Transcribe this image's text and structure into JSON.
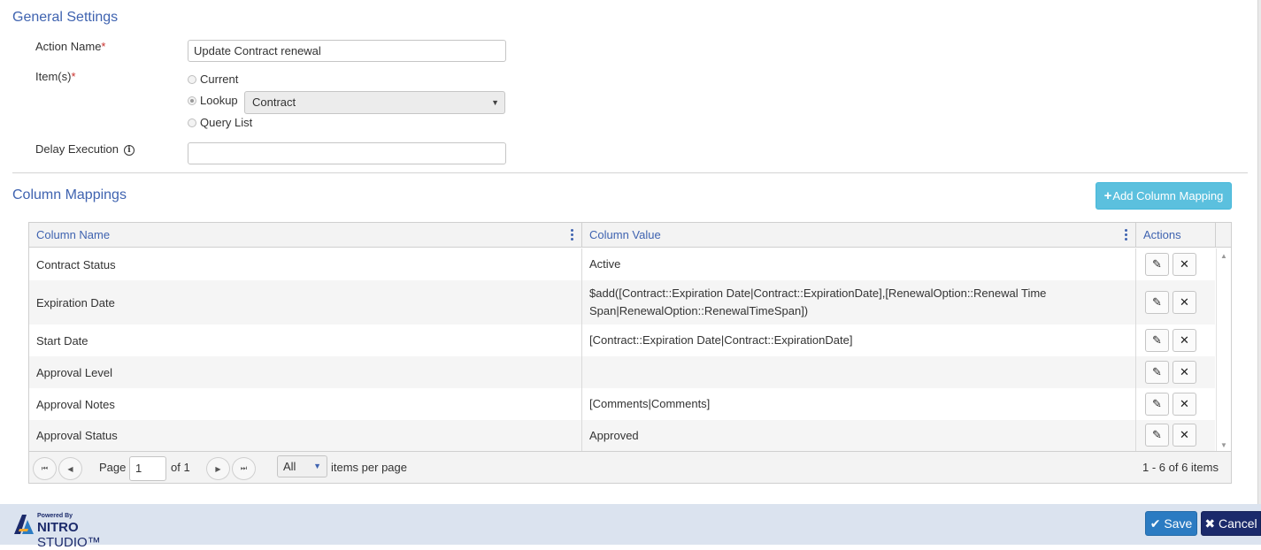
{
  "general": {
    "title": "General Settings",
    "action_name_label": "Action Name",
    "required_mark": "*",
    "action_name_value": "Update Contract renewal",
    "items_label": "Item(s)",
    "radio_options": [
      "Current",
      "Lookup",
      "Query List"
    ],
    "selected_radio": "Lookup",
    "lookup_select_value": "Contract",
    "delay_label": "Delay Execution",
    "info_icon": "i",
    "delay_value": ""
  },
  "mappings": {
    "title": "Column Mappings",
    "add_button_label": "Add Column Mapping",
    "add_button_icon": "+",
    "columns": [
      "Column Name",
      "Column Value",
      "Actions"
    ],
    "rows": [
      {
        "name": "Contract Status",
        "value": "Active"
      },
      {
        "name": "Expiration Date",
        "value": "$add([Contract::Expiration Date|Contract::ExpirationDate],[RenewalOption::Renewal Time Span|RenewalOption::RenewalTimeSpan])"
      },
      {
        "name": "Start Date",
        "value": "[Contract::Expiration Date|Contract::ExpirationDate]"
      },
      {
        "name": "Approval Level",
        "value": ""
      },
      {
        "name": "Approval Notes",
        "value": "[Comments|Comments]"
      },
      {
        "name": "Approval Status",
        "value": "Approved"
      }
    ],
    "edit_icon": "✎",
    "delete_icon": "✕"
  },
  "pager": {
    "first_icon": "⏮",
    "prev_icon": "◀",
    "next_icon": "▶",
    "last_icon": "⏭",
    "page_label": "Page",
    "page_value": "1",
    "of_label": "of 1",
    "page_size": "All",
    "items_per_page_label": "items per page",
    "summary": "1 - 6 of 6 items"
  },
  "footer": {
    "powered_by": "Powered By",
    "brand_bold": "NITRO",
    "brand_light": " STUDIO™",
    "save_label": "Save",
    "save_icon": "✔",
    "cancel_label": "Cancel",
    "cancel_icon": "✖"
  },
  "colors": {
    "accent_blue": "#3f63b0",
    "add_button": "#5bc0de",
    "save_button": "#2b7bc2",
    "cancel_button": "#1b2a6b",
    "footer_bg": "#dbe3ef"
  }
}
